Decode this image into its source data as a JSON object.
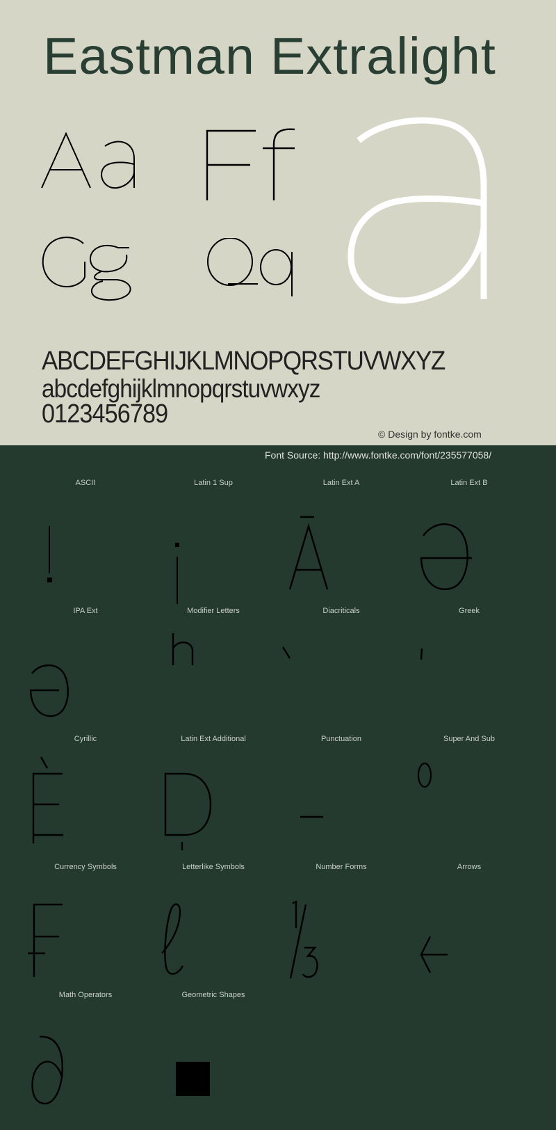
{
  "header": {
    "title": "Eastman Extralight"
  },
  "specimen": {
    "pairs": [
      "Aa",
      "Ff",
      "Gg",
      "Qq"
    ],
    "hero_glyph": "a",
    "uppercase": "ABCDEFGHIJKLMNOPQRSTUVWXYZ",
    "lowercase": "abcdefghijklmnopqrstuvwxyz",
    "digits": "0123456789",
    "credit": "© Design by fontke.com"
  },
  "source": {
    "text": "Font Source: http://www.fontke.com/font/235577058/"
  },
  "colors": {
    "top_bg": "#d5d6c6",
    "bottom_bg": "#243a2f",
    "title": "#2a3f33",
    "label": "#c9cfc9"
  },
  "blocks": [
    {
      "label": "ASCII",
      "glyph": "!"
    },
    {
      "label": "Latin 1 Sup",
      "glyph": "¡"
    },
    {
      "label": "Latin Ext A",
      "glyph": "Ā"
    },
    {
      "label": "Latin Ext B",
      "glyph": "Ə"
    },
    {
      "label": "IPA Ext",
      "glyph": "ə"
    },
    {
      "label": "Modifier Letters",
      "glyph": "ʰ"
    },
    {
      "label": "Diacriticals",
      "glyph": "̀"
    },
    {
      "label": "Greek",
      "glyph": "ʹ"
    },
    {
      "label": "Cyrillic",
      "glyph": "Ѐ"
    },
    {
      "label": "Latin Ext Additional",
      "glyph": "Ḍ"
    },
    {
      "label": "Punctuation",
      "glyph": "‒"
    },
    {
      "label": "Super And Sub",
      "glyph": "⁰"
    },
    {
      "label": "Currency Symbols",
      "glyph": "₣"
    },
    {
      "label": "Letterlike Symbols",
      "glyph": "ℓ"
    },
    {
      "label": "Number Forms",
      "glyph": "⅓"
    },
    {
      "label": "Arrows",
      "glyph": "←"
    },
    {
      "label": "Math Operators",
      "glyph": "∂"
    },
    {
      "label": "Geometric Shapes",
      "glyph": "■"
    }
  ]
}
